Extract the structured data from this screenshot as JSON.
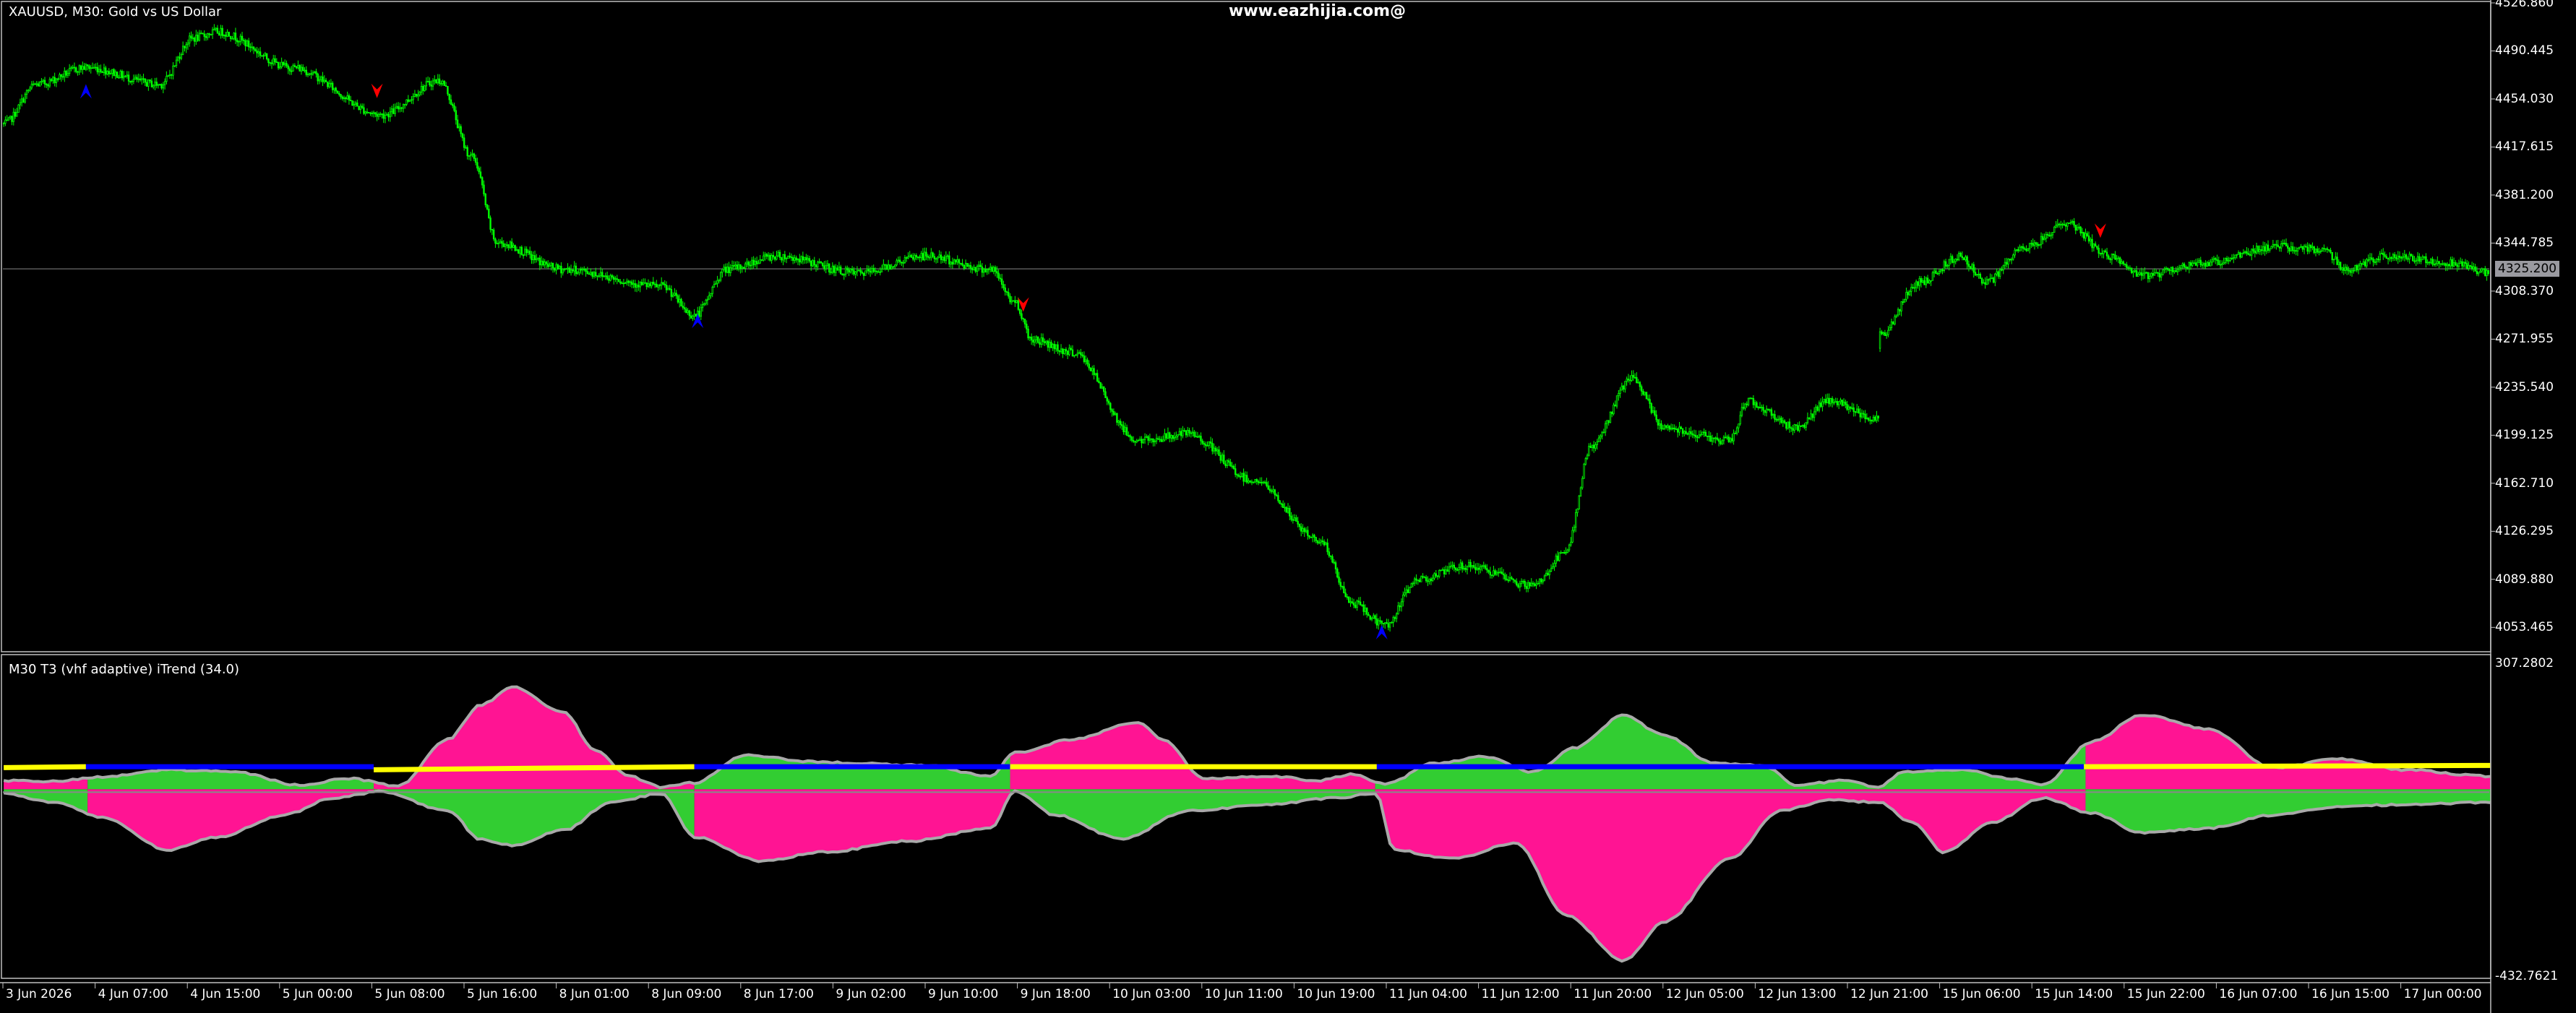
{
  "window": {
    "symbol_title": "XAUUSD, M30:  Gold vs US Dollar",
    "watermark": "www.eazhijia.com@"
  },
  "indicator": {
    "title": "M30 T3 (vhf adaptive) iTrend (34.0)",
    "max_label": "307.2802",
    "min_label": "-432.7621"
  },
  "price_axis": {
    "labels": [
      "4526.860",
      "4490.445",
      "4454.030",
      "4417.615",
      "4381.200",
      "4344.785",
      "4308.370",
      "4271.955",
      "4235.540",
      "4199.125",
      "4162.710",
      "4126.295",
      "4089.880",
      "4053.465"
    ],
    "current_price": "4325.200"
  },
  "time_axis": {
    "labels": [
      "3 Jun 2026",
      "4 Jun 07:00",
      "4 Jun 15:00",
      "5 Jun 00:00",
      "5 Jun 08:00",
      "5 Jun 16:00",
      "8 Jun 01:00",
      "8 Jun 09:00",
      "8 Jun 17:00",
      "9 Jun 02:00",
      "9 Jun 10:00",
      "9 Jun 18:00",
      "10 Jun 03:00",
      "10 Jun 11:00",
      "10 Jun 19:00",
      "11 Jun 04:00",
      "11 Jun 12:00",
      "11 Jun 20:00",
      "12 Jun 05:00",
      "12 Jun 13:00",
      "12 Jun 21:00",
      "15 Jun 06:00",
      "15 Jun 14:00",
      "15 Jun 22:00",
      "16 Jun 07:00",
      "16 Jun 15:00",
      "17 Jun 00:00"
    ]
  },
  "colors": {
    "background": "#000000",
    "frame": "#c0c0c0",
    "candle": "#00ff00",
    "price_line": "#5a5a5a",
    "up_arrow": "#0000ff",
    "down_arrow": "#ff0000",
    "bull_fill": "#32cd32",
    "bear_fill": "#ff1493",
    "outline": "#a9a9a9",
    "trend_up": "#ffff00",
    "trend_down": "#0000ff"
  },
  "chart_data": {
    "type": "candlestick",
    "symbol": "XAUUSD",
    "timeframe": "M30",
    "ylim": [
      4035,
      4526.86
    ],
    "current_price": 4325.2,
    "price_anchors": [
      [
        0,
        4435
      ],
      [
        20,
        4465
      ],
      [
        50,
        4478
      ],
      [
        95,
        4465
      ],
      [
        115,
        4500
      ],
      [
        130,
        4505
      ],
      [
        175,
        4478
      ],
      [
        230,
        4442
      ],
      [
        265,
        4468
      ],
      [
        285,
        4410
      ],
      [
        300,
        4345
      ],
      [
        340,
        4325
      ],
      [
        400,
        4312
      ],
      [
        420,
        4290
      ],
      [
        440,
        4325
      ],
      [
        470,
        4335
      ],
      [
        520,
        4322
      ],
      [
        560,
        4335
      ],
      [
        600,
        4325
      ],
      [
        615,
        4300
      ],
      [
        625,
        4272
      ],
      [
        650,
        4262
      ],
      [
        690,
        4195
      ],
      [
        720,
        4200
      ],
      [
        760,
        4165
      ],
      [
        800,
        4120
      ],
      [
        820,
        4072
      ],
      [
        840,
        4055
      ],
      [
        860,
        4090
      ],
      [
        890,
        4100
      ],
      [
        930,
        4085
      ],
      [
        950,
        4110
      ],
      [
        965,
        4190
      ],
      [
        990,
        4242
      ],
      [
        1010,
        4205
      ],
      [
        1050,
        4195
      ],
      [
        1060,
        4225
      ],
      [
        1090,
        4205
      ],
      [
        1110,
        4225
      ],
      [
        1140,
        4212
      ]
    ],
    "gap_start_index": 1141,
    "price_anchors_after_gap": [
      [
        1141,
        4275
      ],
      [
        1165,
        4315
      ],
      [
        1190,
        4335
      ],
      [
        1205,
        4315
      ],
      [
        1230,
        4342
      ],
      [
        1255,
        4360
      ],
      [
        1280,
        4335
      ],
      [
        1300,
        4320
      ],
      [
        1340,
        4330
      ],
      [
        1380,
        4342
      ],
      [
        1410,
        4340
      ],
      [
        1425,
        4325
      ],
      [
        1450,
        4335
      ],
      [
        1490,
        4330
      ],
      [
        1512,
        4322
      ]
    ],
    "total_bars": 1512,
    "arrows": [
      {
        "index": 50,
        "price": 4462,
        "direction": "up"
      },
      {
        "index": 227,
        "price": 4458,
        "direction": "down"
      },
      {
        "index": 422,
        "price": 4288,
        "direction": "up"
      },
      {
        "index": 620,
        "price": 4296,
        "direction": "down"
      },
      {
        "index": 838,
        "price": 4052,
        "direction": "up"
      },
      {
        "index": 1275,
        "price": 4352,
        "direction": "down"
      }
    ],
    "indicator": {
      "name": "M30 T3 (vhf adaptive) iTrend",
      "period": 34.0,
      "ylim": [
        -432.7621,
        307.2802
      ],
      "upper_anchors": [
        [
          0,
          20
        ],
        [
          30,
          18
        ],
        [
          60,
          28
        ],
        [
          100,
          45
        ],
        [
          140,
          40
        ],
        [
          180,
          10
        ],
        [
          210,
          25
        ],
        [
          240,
          8
        ],
        [
          270,
          115
        ],
        [
          290,
          195
        ],
        [
          310,
          235
        ],
        [
          340,
          180
        ],
        [
          360,
          90
        ],
        [
          380,
          30
        ],
        [
          400,
          5
        ],
        [
          420,
          15
        ],
        [
          450,
          78
        ],
        [
          500,
          62
        ],
        [
          560,
          55
        ],
        [
          600,
          30
        ],
        [
          615,
          85
        ],
        [
          650,
          115
        ],
        [
          690,
          155
        ],
        [
          705,
          115
        ],
        [
          730,
          25
        ],
        [
          770,
          30
        ],
        [
          800,
          20
        ],
        [
          820,
          35
        ],
        [
          840,
          12
        ],
        [
          870,
          60
        ],
        [
          900,
          75
        ],
        [
          930,
          40
        ],
        [
          955,
          95
        ],
        [
          985,
          170
        ],
        [
          1010,
          125
        ],
        [
          1040,
          60
        ],
        [
          1070,
          55
        ],
        [
          1090,
          10
        ],
        [
          1120,
          20
        ],
        [
          1140,
          5
        ],
        [
          1155,
          40
        ],
        [
          1190,
          45
        ],
        [
          1220,
          25
        ],
        [
          1240,
          10
        ],
        [
          1270,
          110
        ],
        [
          1300,
          172
        ],
        [
          1340,
          140
        ],
        [
          1380,
          50
        ],
        [
          1420,
          70
        ],
        [
          1460,
          45
        ],
        [
          1512,
          30
        ]
      ],
      "lower_anchors": [
        [
          0,
          -10
        ],
        [
          30,
          -30
        ],
        [
          60,
          -65
        ],
        [
          100,
          -140
        ],
        [
          130,
          -110
        ],
        [
          170,
          -60
        ],
        [
          200,
          -20
        ],
        [
          230,
          -5
        ],
        [
          270,
          -50
        ],
        [
          290,
          -115
        ],
        [
          310,
          -130
        ],
        [
          340,
          -95
        ],
        [
          370,
          -30
        ],
        [
          400,
          -10
        ],
        [
          420,
          -110
        ],
        [
          460,
          -165
        ],
        [
          500,
          -145
        ],
        [
          550,
          -120
        ],
        [
          600,
          -90
        ],
        [
          615,
          -5
        ],
        [
          640,
          -60
        ],
        [
          680,
          -115
        ],
        [
          720,
          -50
        ],
        [
          770,
          -35
        ],
        [
          810,
          -20
        ],
        [
          835,
          -10
        ],
        [
          845,
          -140
        ],
        [
          880,
          -160
        ],
        [
          920,
          -125
        ],
        [
          950,
          -290
        ],
        [
          985,
          -395
        ],
        [
          1010,
          -305
        ],
        [
          1050,
          -160
        ],
        [
          1080,
          -50
        ],
        [
          1110,
          -25
        ],
        [
          1140,
          -30
        ],
        [
          1160,
          -75
        ],
        [
          1180,
          -145
        ],
        [
          1210,
          -75
        ],
        [
          1240,
          -20
        ],
        [
          1270,
          -55
        ],
        [
          1300,
          -100
        ],
        [
          1340,
          -90
        ],
        [
          1380,
          -60
        ],
        [
          1420,
          -40
        ],
        [
          1460,
          -35
        ],
        [
          1512,
          -30
        ]
      ],
      "trend_segments": [
        {
          "start": 0,
          "end": 50,
          "color": "up",
          "y1": 50,
          "y2": 52
        },
        {
          "start": 50,
          "end": 225,
          "color": "down",
          "y1": 52,
          "y2": 52
        },
        {
          "start": 225,
          "end": 420,
          "color": "up",
          "y1": 45,
          "y2": 52
        },
        {
          "start": 420,
          "end": 612,
          "color": "down",
          "y1": 52,
          "y2": 52
        },
        {
          "start": 612,
          "end": 835,
          "color": "up",
          "y1": 52,
          "y2": 52
        },
        {
          "start": 835,
          "end": 1265,
          "color": "down",
          "y1": 52,
          "y2": 52
        },
        {
          "start": 1265,
          "end": 1512,
          "color": "up",
          "y1": 52,
          "y2": 55
        }
      ]
    }
  }
}
